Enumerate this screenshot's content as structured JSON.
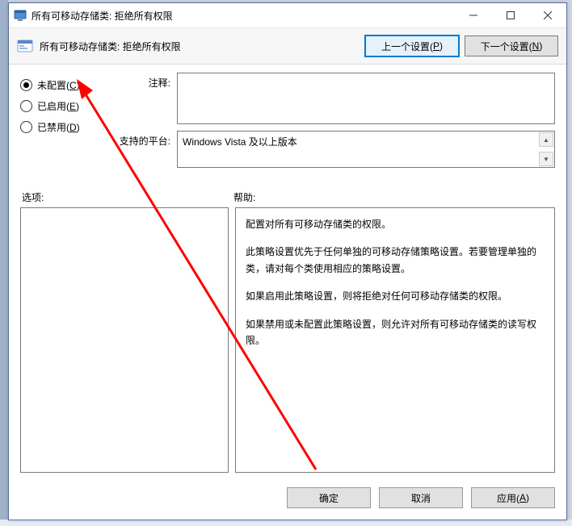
{
  "window": {
    "title": "所有可移动存储类: 拒绝所有权限"
  },
  "header": {
    "policy_title": "所有可移动存储类: 拒绝所有权限",
    "prev_button": "上一个设置(",
    "prev_key": "P",
    "prev_tail": ")",
    "next_button": "下一个设置(",
    "next_key": "N",
    "next_tail": ")"
  },
  "radios": {
    "not_configured": "未配置(",
    "not_configured_key": "C",
    "not_configured_tail": ")",
    "enabled": "已启用(",
    "enabled_key": "E",
    "enabled_tail": ")",
    "disabled": "已禁用(",
    "disabled_key": "D",
    "disabled_tail": ")"
  },
  "fields": {
    "comment_label": "注释:",
    "comment_value": "",
    "platform_label": "支持的平台:",
    "platform_value": "Windows Vista 及以上版本"
  },
  "labels": {
    "options": "选项:",
    "help": "帮助:"
  },
  "help": {
    "p1": "配置对所有可移动存储类的权限。",
    "p2": "此策略设置优先于任何单独的可移动存储策略设置。若要管理单独的类，请对每个类使用相应的策略设置。",
    "p3": "如果启用此策略设置，则将拒绝对任何可移动存储类的权限。",
    "p4": "如果禁用或未配置此策略设置，则允许对所有可移动存储类的读写权限。"
  },
  "footer": {
    "ok": "确定",
    "cancel": "取消",
    "apply": "应用(",
    "apply_key": "A",
    "apply_tail": ")"
  }
}
